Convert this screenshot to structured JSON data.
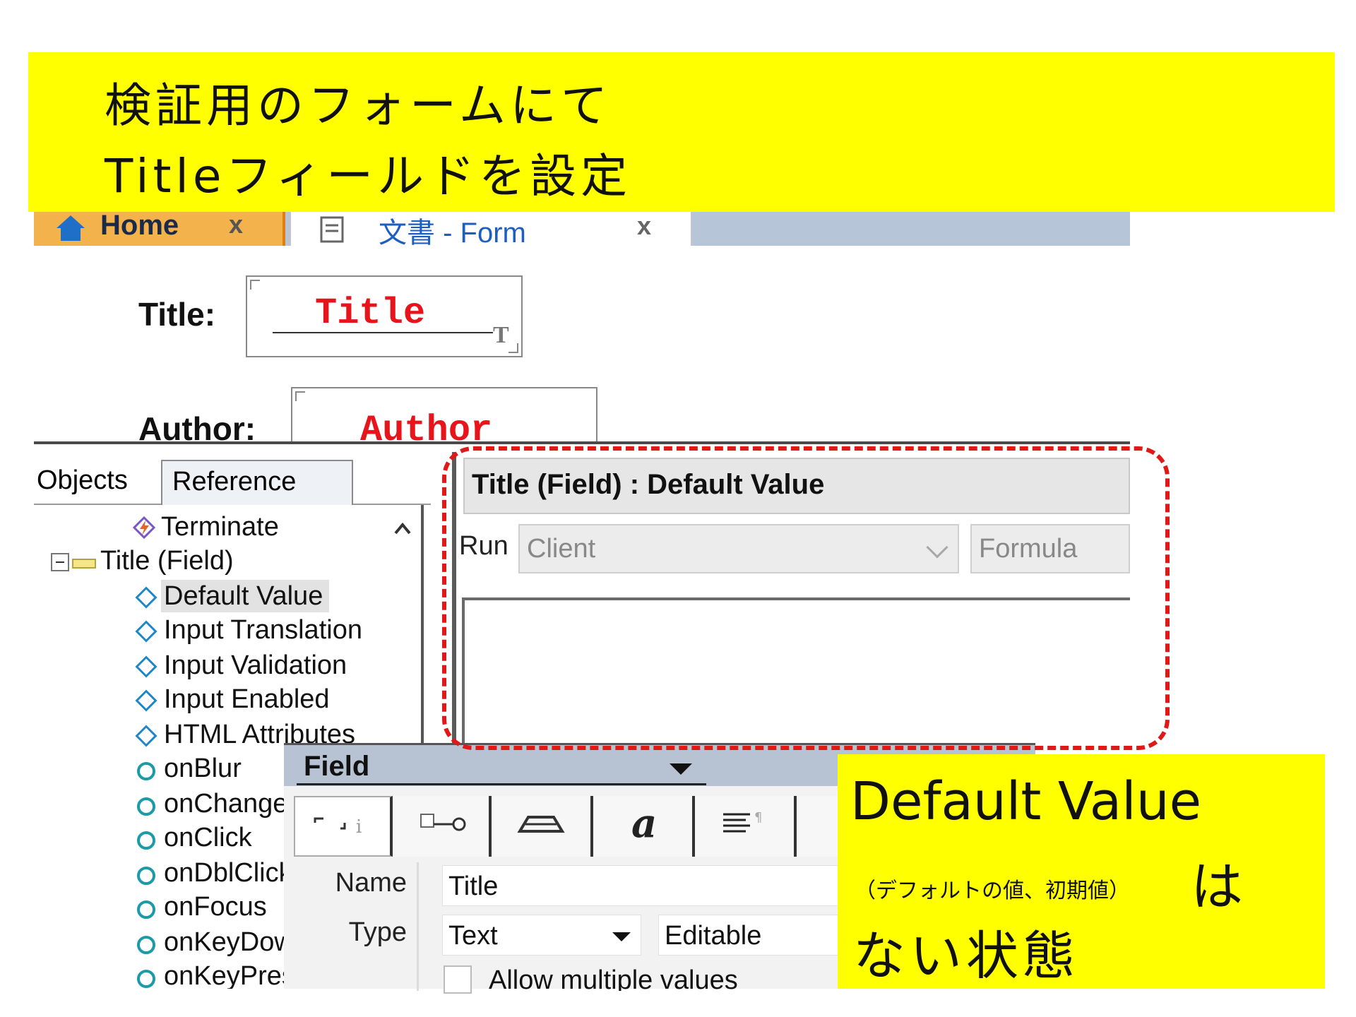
{
  "callout_top": {
    "line1": "検証用のフォームにて",
    "line2": "Titleフィールドを設定"
  },
  "tabs": {
    "home_label": "Home",
    "doc_label": "文書 - Form",
    "close_glyph": "x"
  },
  "form": {
    "title_label": "Title:",
    "title_field": "Title",
    "title_type_mark": "T",
    "author_label": "Author:",
    "author_field": "Author"
  },
  "objects_panel": {
    "tab_objects": "Objects",
    "tab_reference": "Reference",
    "items": [
      {
        "label": "Terminate",
        "icon": "terminate-icon"
      },
      {
        "label": "Title (Field)",
        "icon": "field-icon"
      },
      {
        "label": "Default Value",
        "icon": "diamond-icon",
        "selected": true
      },
      {
        "label": "Input Translation",
        "icon": "diamond-icon"
      },
      {
        "label": "Input Validation",
        "icon": "diamond-icon"
      },
      {
        "label": "Input Enabled",
        "icon": "diamond-icon"
      },
      {
        "label": "HTML Attributes",
        "icon": "diamond-icon"
      },
      {
        "label": "onBlur",
        "icon": "circle-icon"
      },
      {
        "label": "onChange",
        "icon": "circle-icon"
      },
      {
        "label": "onClick",
        "icon": "circle-icon"
      },
      {
        "label": "onDblClick",
        "icon": "circle-icon"
      },
      {
        "label": "onFocus",
        "icon": "circle-icon"
      },
      {
        "label": "onKeyDown",
        "icon": "circle-icon"
      },
      {
        "label": "onKeyPress",
        "icon": "circle-icon"
      }
    ]
  },
  "editor": {
    "header_title": "Title (Field) : Default Value",
    "run_label": "Run",
    "run_target": "Client",
    "language": "Formula",
    "body": ""
  },
  "field_props": {
    "title": "Field",
    "name_label": "Name",
    "name_value": "Title",
    "type_label": "Type",
    "type_value": "Text",
    "editable_value": "Editable",
    "allow_multiple": "Allow multiple values"
  },
  "callout_bottom": {
    "line1": "Default Value",
    "line2_small": "（デフォルトの値、初期値）",
    "line2_big": "は",
    "line3": "ない状態"
  },
  "colors": {
    "callout_yellow": "#ffff00",
    "highlight_red": "#e01818",
    "field_text_red": "#e8141b",
    "home_tab_orange": "#f4b24c"
  }
}
